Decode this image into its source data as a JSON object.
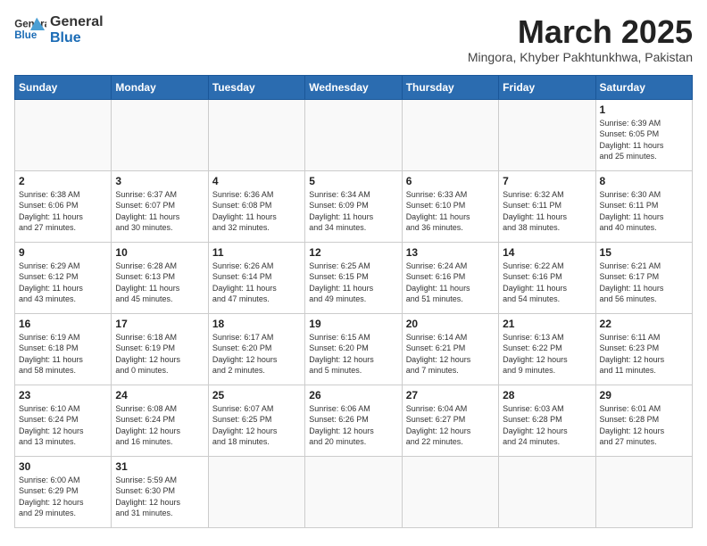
{
  "header": {
    "logo_line1": "General",
    "logo_line2": "Blue",
    "month_title": "March 2025",
    "subtitle": "Mingora, Khyber Pakhtunkhwa, Pakistan"
  },
  "weekdays": [
    "Sunday",
    "Monday",
    "Tuesday",
    "Wednesday",
    "Thursday",
    "Friday",
    "Saturday"
  ],
  "weeks": [
    [
      {
        "day": "",
        "info": ""
      },
      {
        "day": "",
        "info": ""
      },
      {
        "day": "",
        "info": ""
      },
      {
        "day": "",
        "info": ""
      },
      {
        "day": "",
        "info": ""
      },
      {
        "day": "",
        "info": ""
      },
      {
        "day": "1",
        "info": "Sunrise: 6:39 AM\nSunset: 6:05 PM\nDaylight: 11 hours\nand 25 minutes."
      }
    ],
    [
      {
        "day": "2",
        "info": "Sunrise: 6:38 AM\nSunset: 6:06 PM\nDaylight: 11 hours\nand 27 minutes."
      },
      {
        "day": "3",
        "info": "Sunrise: 6:37 AM\nSunset: 6:07 PM\nDaylight: 11 hours\nand 30 minutes."
      },
      {
        "day": "4",
        "info": "Sunrise: 6:36 AM\nSunset: 6:08 PM\nDaylight: 11 hours\nand 32 minutes."
      },
      {
        "day": "5",
        "info": "Sunrise: 6:34 AM\nSunset: 6:09 PM\nDaylight: 11 hours\nand 34 minutes."
      },
      {
        "day": "6",
        "info": "Sunrise: 6:33 AM\nSunset: 6:10 PM\nDaylight: 11 hours\nand 36 minutes."
      },
      {
        "day": "7",
        "info": "Sunrise: 6:32 AM\nSunset: 6:11 PM\nDaylight: 11 hours\nand 38 minutes."
      },
      {
        "day": "8",
        "info": "Sunrise: 6:30 AM\nSunset: 6:11 PM\nDaylight: 11 hours\nand 40 minutes."
      }
    ],
    [
      {
        "day": "9",
        "info": "Sunrise: 6:29 AM\nSunset: 6:12 PM\nDaylight: 11 hours\nand 43 minutes."
      },
      {
        "day": "10",
        "info": "Sunrise: 6:28 AM\nSunset: 6:13 PM\nDaylight: 11 hours\nand 45 minutes."
      },
      {
        "day": "11",
        "info": "Sunrise: 6:26 AM\nSunset: 6:14 PM\nDaylight: 11 hours\nand 47 minutes."
      },
      {
        "day": "12",
        "info": "Sunrise: 6:25 AM\nSunset: 6:15 PM\nDaylight: 11 hours\nand 49 minutes."
      },
      {
        "day": "13",
        "info": "Sunrise: 6:24 AM\nSunset: 6:16 PM\nDaylight: 11 hours\nand 51 minutes."
      },
      {
        "day": "14",
        "info": "Sunrise: 6:22 AM\nSunset: 6:16 PM\nDaylight: 11 hours\nand 54 minutes."
      },
      {
        "day": "15",
        "info": "Sunrise: 6:21 AM\nSunset: 6:17 PM\nDaylight: 11 hours\nand 56 minutes."
      }
    ],
    [
      {
        "day": "16",
        "info": "Sunrise: 6:19 AM\nSunset: 6:18 PM\nDaylight: 11 hours\nand 58 minutes."
      },
      {
        "day": "17",
        "info": "Sunrise: 6:18 AM\nSunset: 6:19 PM\nDaylight: 12 hours\nand 0 minutes."
      },
      {
        "day": "18",
        "info": "Sunrise: 6:17 AM\nSunset: 6:20 PM\nDaylight: 12 hours\nand 2 minutes."
      },
      {
        "day": "19",
        "info": "Sunrise: 6:15 AM\nSunset: 6:20 PM\nDaylight: 12 hours\nand 5 minutes."
      },
      {
        "day": "20",
        "info": "Sunrise: 6:14 AM\nSunset: 6:21 PM\nDaylight: 12 hours\nand 7 minutes."
      },
      {
        "day": "21",
        "info": "Sunrise: 6:13 AM\nSunset: 6:22 PM\nDaylight: 12 hours\nand 9 minutes."
      },
      {
        "day": "22",
        "info": "Sunrise: 6:11 AM\nSunset: 6:23 PM\nDaylight: 12 hours\nand 11 minutes."
      }
    ],
    [
      {
        "day": "23",
        "info": "Sunrise: 6:10 AM\nSunset: 6:24 PM\nDaylight: 12 hours\nand 13 minutes."
      },
      {
        "day": "24",
        "info": "Sunrise: 6:08 AM\nSunset: 6:24 PM\nDaylight: 12 hours\nand 16 minutes."
      },
      {
        "day": "25",
        "info": "Sunrise: 6:07 AM\nSunset: 6:25 PM\nDaylight: 12 hours\nand 18 minutes."
      },
      {
        "day": "26",
        "info": "Sunrise: 6:06 AM\nSunset: 6:26 PM\nDaylight: 12 hours\nand 20 minutes."
      },
      {
        "day": "27",
        "info": "Sunrise: 6:04 AM\nSunset: 6:27 PM\nDaylight: 12 hours\nand 22 minutes."
      },
      {
        "day": "28",
        "info": "Sunrise: 6:03 AM\nSunset: 6:28 PM\nDaylight: 12 hours\nand 24 minutes."
      },
      {
        "day": "29",
        "info": "Sunrise: 6:01 AM\nSunset: 6:28 PM\nDaylight: 12 hours\nand 27 minutes."
      }
    ],
    [
      {
        "day": "30",
        "info": "Sunrise: 6:00 AM\nSunset: 6:29 PM\nDaylight: 12 hours\nand 29 minutes."
      },
      {
        "day": "31",
        "info": "Sunrise: 5:59 AM\nSunset: 6:30 PM\nDaylight: 12 hours\nand 31 minutes."
      },
      {
        "day": "",
        "info": ""
      },
      {
        "day": "",
        "info": ""
      },
      {
        "day": "",
        "info": ""
      },
      {
        "day": "",
        "info": ""
      },
      {
        "day": "",
        "info": ""
      }
    ]
  ]
}
